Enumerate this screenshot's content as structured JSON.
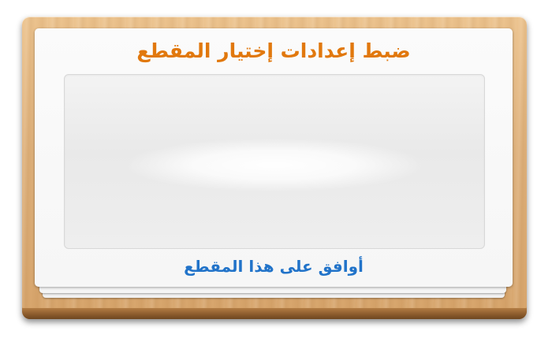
{
  "dialog": {
    "title": "ضبط إعدادات إختيار المقطع",
    "agree_label": "أوافق على هذا المقطع"
  },
  "colors": {
    "title": "#e1780d",
    "agree_link": "#2173c9",
    "wood": "#deb07a"
  }
}
